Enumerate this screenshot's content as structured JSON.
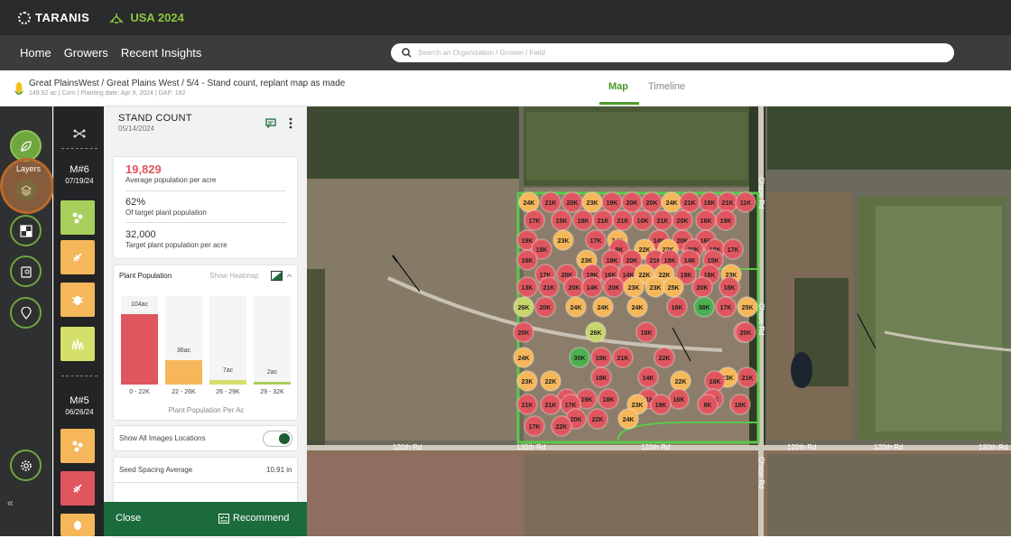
{
  "topbar": {
    "brand": "TARANIS",
    "season": "USA 2024"
  },
  "nav": {
    "items": [
      "Home",
      "Growers",
      "Recent Insights"
    ]
  },
  "search": {
    "placeholder": "Search an Organization / Grower / Field"
  },
  "breadcrumb": {
    "path": "Great PlainsWest / Great Plains West / 5/4 - Stand count, replant map as made",
    "meta": "149.92 ac | Corn | Planting date: Apr 9, 2024 | DAP: 182"
  },
  "view_tabs": {
    "map": "Map",
    "timeline": "Timeline"
  },
  "rail": {
    "layers_label": "Layers"
  },
  "timeline": [
    {
      "mission": "M#6",
      "date": "07/19/24"
    },
    {
      "mission": "M#5",
      "date": "06/26/24"
    }
  ],
  "panel": {
    "title": "STAND COUNT",
    "date": "05/14/2024",
    "population": {
      "value": "19,829",
      "label": "Average population per acre"
    },
    "target_pct": {
      "value": "62%",
      "label": "Of target plant population"
    },
    "target_pop": {
      "value": "32,000",
      "label": "Target plant population per acre"
    },
    "chart_title": "Plant Population",
    "heatmap_link": "Show Heatmap",
    "show_images": "Show All Images Locations",
    "seed_spacing_label": "Seed Spacing Average",
    "seed_spacing_value": "10.91 in",
    "close": "Close",
    "recommend": "Recommend"
  },
  "chart_data": {
    "type": "bar",
    "categories": [
      "0 - 22K",
      "22 - 26K",
      "26 - 29K",
      "29 - 32K"
    ],
    "values": [
      104,
      36,
      7,
      2
    ],
    "value_labels": [
      "104ac",
      "36ac",
      "7ac",
      "2ac"
    ],
    "colors": [
      "#e0565f",
      "#f5b75a",
      "#d4e06a",
      "#a8cf5b"
    ],
    "xlabel": "Plant Population Per Ac",
    "ylim": [
      0,
      130
    ]
  },
  "map": {
    "road_labels": {
      "road_120th": "120th Rd",
      "road_chase": "Chase Rd"
    },
    "markers": [
      {
        "v": "24K",
        "c": "y"
      },
      {
        "v": "21K",
        "c": "r"
      },
      {
        "v": "20K",
        "c": "r"
      },
      {
        "v": "23K",
        "c": "y"
      },
      {
        "v": "19K",
        "c": "r"
      },
      {
        "v": "20K",
        "c": "r"
      },
      {
        "v": "20K",
        "c": "r"
      },
      {
        "v": "24K",
        "c": "y"
      },
      {
        "v": "21K",
        "c": "r"
      },
      {
        "v": "18K",
        "c": "r"
      },
      {
        "v": "21K",
        "c": "r"
      },
      {
        "v": "11K",
        "c": "r"
      },
      {
        "v": "17K",
        "c": "r"
      },
      {
        "v": "15K",
        "c": "r"
      },
      {
        "v": "18K",
        "c": "r"
      },
      {
        "v": "21K",
        "c": "r"
      },
      {
        "v": "21K",
        "c": "r"
      },
      {
        "v": "10K",
        "c": "r"
      },
      {
        "v": "21K",
        "c": "r"
      },
      {
        "v": "20K",
        "c": "r"
      },
      {
        "v": "16K",
        "c": "r"
      },
      {
        "v": "19K",
        "c": "r"
      },
      {
        "v": "19K",
        "c": "r"
      },
      {
        "v": "23K",
        "c": "y"
      },
      {
        "v": "17K",
        "c": "r"
      },
      {
        "v": "24K",
        "c": "y"
      },
      {
        "v": "14K",
        "c": "r"
      },
      {
        "v": "20K",
        "c": "r"
      },
      {
        "v": "16K",
        "c": "r"
      },
      {
        "v": "18K",
        "c": "r"
      },
      {
        "v": "9K",
        "c": "r"
      },
      {
        "v": "22K",
        "c": "y"
      },
      {
        "v": "22K",
        "c": "y"
      },
      {
        "v": "20K",
        "c": "r"
      },
      {
        "v": "18K",
        "c": "r"
      },
      {
        "v": "17K",
        "c": "r"
      },
      {
        "v": "16K",
        "c": "r"
      },
      {
        "v": "23K",
        "c": "y"
      },
      {
        "v": "18K",
        "c": "r"
      },
      {
        "v": "20K",
        "c": "r"
      },
      {
        "v": "21K",
        "c": "r"
      },
      {
        "v": "18K",
        "c": "r"
      },
      {
        "v": "14K",
        "c": "r"
      },
      {
        "v": "15K",
        "c": "r"
      },
      {
        "v": "17K",
        "c": "r"
      },
      {
        "v": "20K",
        "c": "r"
      },
      {
        "v": "19K",
        "c": "r"
      },
      {
        "v": "16K",
        "c": "r"
      },
      {
        "v": "14K",
        "c": "r"
      },
      {
        "v": "22K",
        "c": "y"
      },
      {
        "v": "22K",
        "c": "y"
      },
      {
        "v": "19K",
        "c": "r"
      },
      {
        "v": "18K",
        "c": "r"
      },
      {
        "v": "23K",
        "c": "y"
      },
      {
        "v": "13K",
        "c": "r"
      },
      {
        "v": "21K",
        "c": "r"
      },
      {
        "v": "20K",
        "c": "r"
      },
      {
        "v": "14K",
        "c": "r"
      },
      {
        "v": "20K",
        "c": "r"
      },
      {
        "v": "23K",
        "c": "y"
      },
      {
        "v": "23K",
        "c": "y"
      },
      {
        "v": "25K",
        "c": "y"
      },
      {
        "v": "20K",
        "c": "r"
      },
      {
        "v": "18K",
        "c": "r"
      },
      {
        "v": "26K",
        "c": "g"
      },
      {
        "v": "20K",
        "c": "r"
      },
      {
        "v": "24K",
        "c": "y"
      },
      {
        "v": "24K",
        "c": "y"
      },
      {
        "v": "24K",
        "c": "y"
      },
      {
        "v": "18K",
        "c": "r"
      },
      {
        "v": "38K",
        "c": "G"
      },
      {
        "v": "17K",
        "c": "r"
      },
      {
        "v": "25K",
        "c": "y"
      },
      {
        "v": "20K",
        "c": "r"
      },
      {
        "v": "26K",
        "c": "g"
      },
      {
        "v": "18K",
        "c": "r"
      },
      {
        "v": "16K",
        "c": "r"
      },
      {
        "v": "20K",
        "c": "r"
      },
      {
        "v": "24K",
        "c": "y"
      },
      {
        "v": "30K",
        "c": "G"
      },
      {
        "v": "19K",
        "c": "r"
      },
      {
        "v": "21K",
        "c": "r"
      },
      {
        "v": "22K",
        "c": "r"
      },
      {
        "v": "18K",
        "c": "r"
      },
      {
        "v": "14K",
        "c": "r"
      },
      {
        "v": "23K",
        "c": "y"
      },
      {
        "v": "21K",
        "c": "r"
      },
      {
        "v": "23K",
        "c": "y"
      },
      {
        "v": "22K",
        "c": "y"
      },
      {
        "v": "22K",
        "c": "y"
      },
      {
        "v": "18K",
        "c": "r"
      },
      {
        "v": "22K",
        "c": "r"
      },
      {
        "v": "19K",
        "c": "r"
      },
      {
        "v": "18K",
        "c": "r"
      },
      {
        "v": "21K",
        "c": "r"
      },
      {
        "v": "16K",
        "c": "r"
      },
      {
        "v": "20K",
        "c": "r"
      },
      {
        "v": "21K",
        "c": "r"
      },
      {
        "v": "21K",
        "c": "r"
      },
      {
        "v": "17K",
        "c": "r"
      },
      {
        "v": "23K",
        "c": "y"
      },
      {
        "v": "19K",
        "c": "r"
      },
      {
        "v": "8K",
        "c": "r"
      },
      {
        "v": "18K",
        "c": "r"
      },
      {
        "v": "22K",
        "c": "r"
      },
      {
        "v": "24K",
        "c": "y"
      },
      {
        "v": "20K",
        "c": "r"
      },
      {
        "v": "17K",
        "c": "r"
      },
      {
        "v": "22K",
        "c": "r"
      }
    ]
  }
}
